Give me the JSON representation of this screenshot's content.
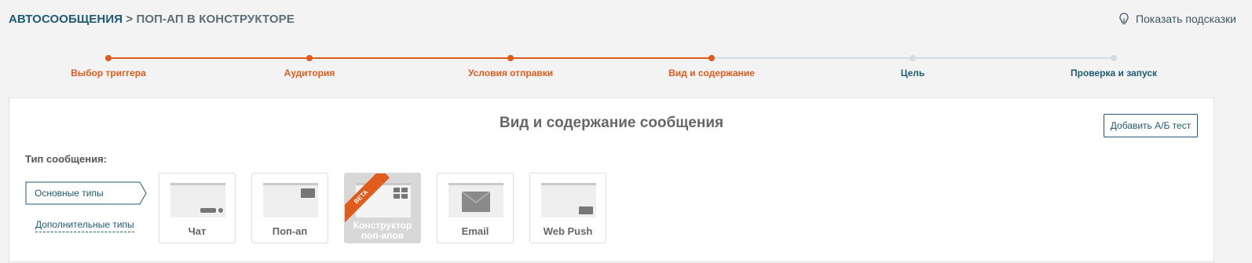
{
  "breadcrumb": {
    "root": "АВТОСООБЩЕНИЯ",
    "separator": " > ",
    "current": "ПОП-АП В КОНСТРУКТОРЕ"
  },
  "hints": {
    "label": "Показать подсказки",
    "icon": "lightbulb-icon"
  },
  "stepper": {
    "steps": [
      {
        "label": "Выбор триггера",
        "state": "done"
      },
      {
        "label": "Аудитория",
        "state": "done"
      },
      {
        "label": "Условия отправки",
        "state": "done"
      },
      {
        "label": "Вид и содержание",
        "state": "current"
      },
      {
        "label": "Цель",
        "state": "pending"
      },
      {
        "label": "Проверка и запуск",
        "state": "pending"
      }
    ],
    "colors": {
      "done": "#e05c1c",
      "pending": "#d3dce6",
      "pending_text": "#1e5a73"
    }
  },
  "card": {
    "title": "Вид и содержание сообщения",
    "ab_button": "Добавить А/Б тест",
    "type_label": "Тип сообщения:",
    "basic_types": "Основные типы",
    "extra_types": "Дополнительные типы",
    "tiles": [
      {
        "label": "Чат",
        "icon": "chat-preview-icon"
      },
      {
        "label": "Поп-ап",
        "icon": "popup-preview-icon"
      },
      {
        "label": "Конструктор поп-апов",
        "icon": "popup-builder-preview-icon",
        "badge": "BETA",
        "selected": true
      },
      {
        "label": "Email",
        "icon": "envelope-icon"
      },
      {
        "label": "Web Push",
        "icon": "web-push-preview-icon"
      }
    ]
  },
  "colors": {
    "accent": "#e05c1c",
    "brand": "#1e5a73",
    "background": "#f3f3f3"
  }
}
